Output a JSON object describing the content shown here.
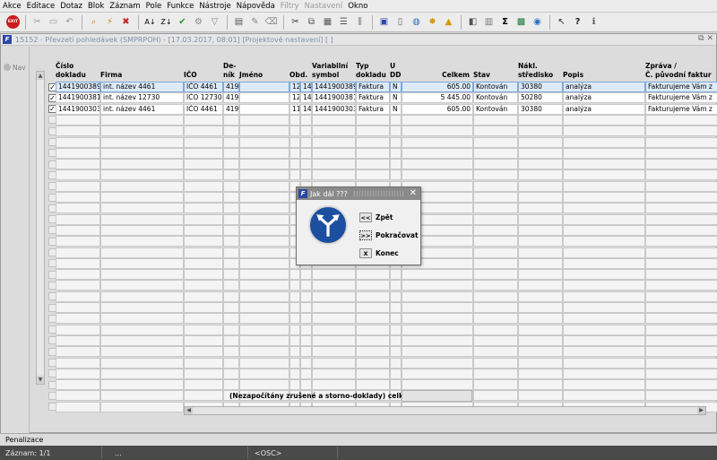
{
  "menubar": {
    "items": [
      "Akce",
      "Editace",
      "Dotaz",
      "Blok",
      "Záznam",
      "Pole",
      "Funkce",
      "Nástroje",
      "Nápověda"
    ],
    "disabled_items": [
      "Filtry",
      "Nastavení"
    ],
    "last_item": "Okno"
  },
  "toolbar": {
    "exit_label": "EXIT"
  },
  "window": {
    "title": "15152 - Převzetí pohledávek (SMPRPOH) - [17.03.2017, 08:01] [Projektové nastavení] [ ]",
    "nav_label": "Nav",
    "controls": "⧉ ✕"
  },
  "columns": [
    {
      "l1": "Číslo",
      "l2": "dokladu"
    },
    {
      "l1": "",
      "l2": "Firma"
    },
    {
      "l1": "",
      "l2": "IČO"
    },
    {
      "l1": "De-",
      "l2": "ník"
    },
    {
      "l1": "",
      "l2": "Jméno"
    },
    {
      "l1": "",
      "l2": "Ob"
    },
    {
      "l1": "",
      "l2": "d."
    },
    {
      "l1": "Variabilní",
      "l2": "symbol"
    },
    {
      "l1": "Typ",
      "l2": "dokladu"
    },
    {
      "l1": "U",
      "l2": "DD"
    },
    {
      "l1": "",
      "l2": "Celkem"
    },
    {
      "l1": "",
      "l2": "Stav"
    },
    {
      "l1": "Nákl.",
      "l2": "středisko"
    },
    {
      "l1": "",
      "l2": "Popis"
    },
    {
      "l1": "Zpráva /",
      "l2": "Č. původní faktur"
    }
  ],
  "rows": [
    {
      "checked": true,
      "cells": [
        "1441900389",
        "int. název 4461",
        "IČO 4461",
        "419",
        "",
        "12",
        "14",
        "1441900389",
        "Faktura",
        "N",
        "605.00",
        "Kontován",
        "30380",
        "analýza",
        "Fakturujeme Vám z"
      ]
    },
    {
      "checked": true,
      "cells": [
        "1441900381",
        "int. název 12730",
        "IČO 12730",
        "419",
        "",
        "12",
        "14",
        "1441900381",
        "Faktura",
        "N",
        "5 445.00",
        "Kontován",
        "50280",
        "analýza",
        "Fakturujeme Vám z"
      ]
    },
    {
      "checked": true,
      "cells": [
        "1441900303",
        "int. název 4461",
        "IČO 4461",
        "419",
        "",
        "11",
        "14",
        "1441900303",
        "Faktura",
        "N",
        "605.00",
        "Kontován",
        "30380",
        "analýza",
        "Fakturujeme Vám z"
      ]
    }
  ],
  "footer": {
    "total_label": "(Nezapočítány zrušené a storno-doklady) celkem",
    "total_value": ""
  },
  "dialog": {
    "title": "Jak dál ???",
    "buttons": [
      {
        "key": "<<",
        "label": "Zpět"
      },
      {
        "key": ">>",
        "label": "Pokračovat"
      },
      {
        "key": "X",
        "label": "Konec"
      }
    ]
  },
  "status": {
    "title": "Penalizace",
    "record": "Záznam: 1/1",
    "seg2": "...",
    "mode": "<OSC>"
  }
}
